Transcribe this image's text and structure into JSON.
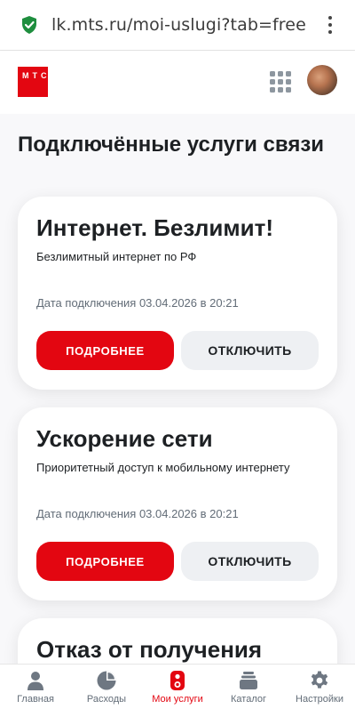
{
  "browser": {
    "url": "lk.mts.ru/moi-uslugi?tab=free",
    "secure_icon": "shield-check-icon",
    "menu_icon": "more-vertical-icon"
  },
  "header": {
    "logo_text": "МТС",
    "apps_icon": "apps-grid-icon",
    "avatar": "user-avatar"
  },
  "main": {
    "section_title": "Подключённые услуги связи",
    "cards": [
      {
        "title": "Интернет. Безлимит!",
        "description": "Безлимитный интернет по РФ",
        "date": "Дата подключения 03.04.2026 в 20:21",
        "primary_label": "Подробнее",
        "secondary_label": "Отключить"
      },
      {
        "title": "Ускорение сети",
        "description": "Приоритетный доступ к мобильному интернету",
        "date": "Дата подключения 03.04.2026 в 20:21",
        "primary_label": "Подробнее",
        "secondary_label": "Отключить"
      },
      {
        "title": "Отказ от получения"
      }
    ]
  },
  "nav": {
    "items": [
      {
        "label": "Главная",
        "icon": "user-icon"
      },
      {
        "label": "Расходы",
        "icon": "pie-chart-icon"
      },
      {
        "label": "Мои услуги",
        "icon": "toggles-icon",
        "active": true
      },
      {
        "label": "Каталог",
        "icon": "stack-icon"
      },
      {
        "label": "Настройки",
        "icon": "gear-icon"
      }
    ]
  },
  "colors": {
    "brand_red": "#e30611",
    "text_primary": "#1d2023",
    "text_secondary": "#626c77",
    "background": "#f8f8fa",
    "secondary_button": "#eef0f3"
  }
}
